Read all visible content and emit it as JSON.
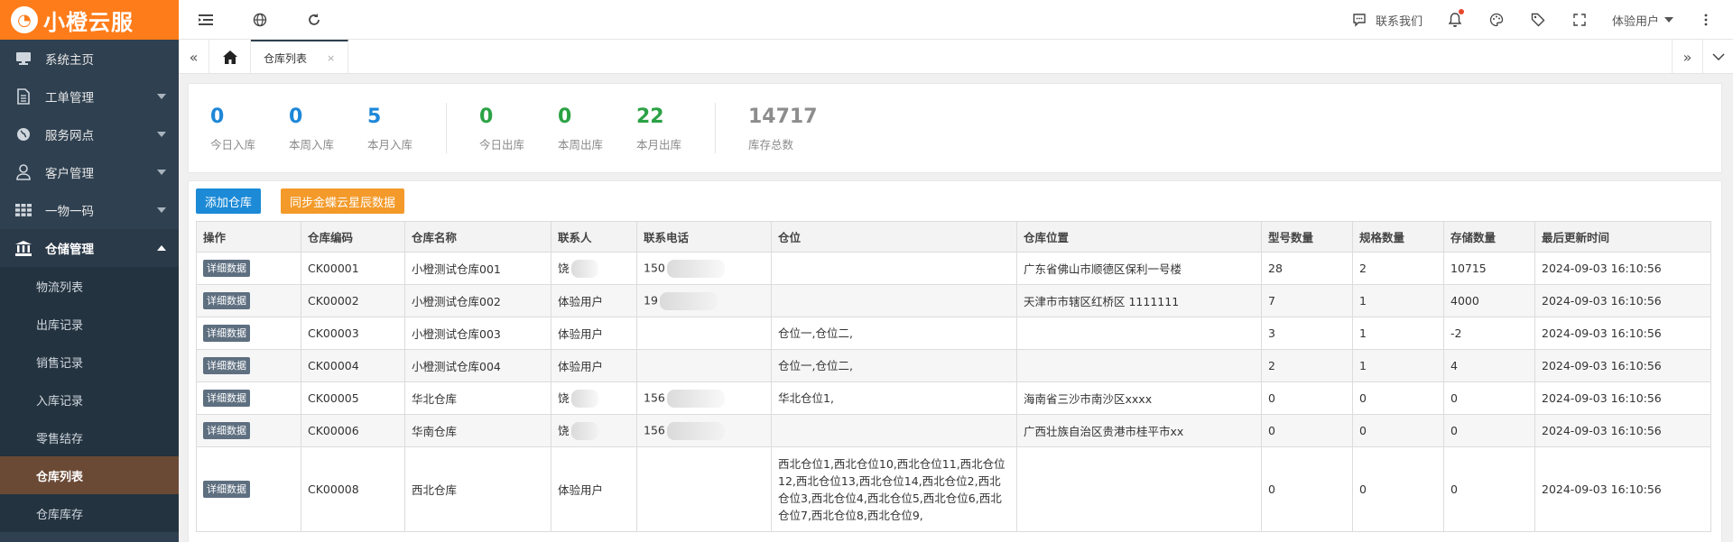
{
  "app": {
    "logo_text": "小橙云服",
    "logo_mark": "◔"
  },
  "sidebar": {
    "items": [
      {
        "label": "系统主页",
        "icon": "monitor-icon"
      },
      {
        "label": "工单管理",
        "icon": "document-icon",
        "has_caret": true
      },
      {
        "label": "服务网点",
        "icon": "globe-icon",
        "has_caret": true
      },
      {
        "label": "客户管理",
        "icon": "user-icon",
        "has_caret": true
      },
      {
        "label": "一物一码",
        "icon": "grid-icon",
        "has_caret": true
      },
      {
        "label": "仓储管理",
        "icon": "bank-icon",
        "open": true
      }
    ],
    "submenu": [
      {
        "label": "物流列表"
      },
      {
        "label": "出库记录"
      },
      {
        "label": "销售记录"
      },
      {
        "label": "入库记录"
      },
      {
        "label": "零售结存"
      },
      {
        "label": "仓库列表",
        "active": true
      },
      {
        "label": "仓库库存"
      }
    ]
  },
  "topbar": {
    "left_icons": [
      "menu-toggle-icon",
      "globe-icon",
      "refresh-icon"
    ],
    "contact_label": "联系我们",
    "user_label": "体验用户",
    "right_icons": [
      "chat-icon",
      "bell-icon",
      "palette-icon",
      "tag-icon",
      "fullscreen-icon",
      "more-icon"
    ]
  },
  "tabs": {
    "active_label": "仓库列表",
    "close_glyph": "×"
  },
  "stats": {
    "inbound": [
      {
        "value": "0",
        "label": "今日入库"
      },
      {
        "value": "0",
        "label": "本周入库"
      },
      {
        "value": "5",
        "label": "本月入库"
      }
    ],
    "outbound": [
      {
        "value": "0",
        "label": "今日出库"
      },
      {
        "value": "0",
        "label": "本周出库"
      },
      {
        "value": "22",
        "label": "本月出库"
      }
    ],
    "total": {
      "value": "14717",
      "label": "库存总数"
    }
  },
  "toolbar": {
    "add_label": "添加仓库",
    "sync_label": "同步金蝶云星辰数据"
  },
  "table": {
    "columns": [
      "操作",
      "仓库编码",
      "仓库名称",
      "联系人",
      "联系电话",
      "仓位",
      "仓库位置",
      "型号数量",
      "规格数量",
      "存储数量",
      "最后更新时间"
    ],
    "detail_label": "详细数据",
    "rows": [
      {
        "code": "CK00001",
        "name": "小橙测试仓库001",
        "contact": "饶",
        "contact_masked": true,
        "phone": "150",
        "phone_masked": true,
        "slots": "",
        "location": "广东省佛山市顺德区保利一号楼",
        "models": "28",
        "specs": "2",
        "stock": "10715",
        "updated": "2024-09-03 16:10:56"
      },
      {
        "code": "CK00002",
        "name": "小橙测试仓库002",
        "contact": "体验用户",
        "contact_masked": false,
        "phone": "19",
        "phone_masked": true,
        "slots": "",
        "location": "天津市市辖区红桥区 1111111",
        "models": "7",
        "specs": "1",
        "stock": "4000",
        "updated": "2024-09-03 16:10:56"
      },
      {
        "code": "CK00003",
        "name": "小橙测试仓库003",
        "contact": "体验用户",
        "contact_masked": false,
        "phone": "",
        "phone_masked": false,
        "slots": "仓位一,仓位二,",
        "location": "",
        "models": "3",
        "specs": "1",
        "stock": "-2",
        "updated": "2024-09-03 16:10:56"
      },
      {
        "code": "CK00004",
        "name": "小橙测试仓库004",
        "contact": "体验用户",
        "contact_masked": false,
        "phone": "",
        "phone_masked": false,
        "slots": "仓位一,仓位二,",
        "location": "",
        "models": "2",
        "specs": "1",
        "stock": "4",
        "updated": "2024-09-03 16:10:56"
      },
      {
        "code": "CK00005",
        "name": "华北仓库",
        "contact": "饶",
        "contact_masked": true,
        "phone": "156",
        "phone_masked": true,
        "slots": "华北仓位1,",
        "location": "海南省三沙市南沙区xxxx",
        "models": "0",
        "specs": "0",
        "stock": "0",
        "updated": "2024-09-03 16:10:56"
      },
      {
        "code": "CK00006",
        "name": "华南仓库",
        "contact": "饶",
        "contact_masked": true,
        "phone": "156",
        "phone_masked": true,
        "slots": "",
        "location": "广西壮族自治区贵港市桂平市xx",
        "models": "0",
        "specs": "0",
        "stock": "0",
        "updated": "2024-09-03 16:10:56"
      },
      {
        "code": "CK00008",
        "name": "西北仓库",
        "contact": "体验用户",
        "contact_masked": false,
        "phone": "",
        "phone_masked": false,
        "slots": "西北仓位1,西北仓位10,西北仓位11,西北仓位12,西北仓位13,西北仓位14,西北仓位2,西北仓位3,西北仓位4,西北仓位5,西北仓位6,西北仓位7,西北仓位8,西北仓位9,",
        "location": "",
        "models": "0",
        "specs": "0",
        "stock": "0",
        "updated": "2024-09-03 16:10:56"
      }
    ]
  },
  "colors": {
    "brand": "#ff7c1a",
    "sidebar": "#2f4050",
    "active_menu": "#6b4a35",
    "stat_blue": "#1e87d8",
    "stat_green": "#2ba245",
    "btn_blue": "#1c8ad6",
    "btn_orange": "#f39a2a"
  }
}
